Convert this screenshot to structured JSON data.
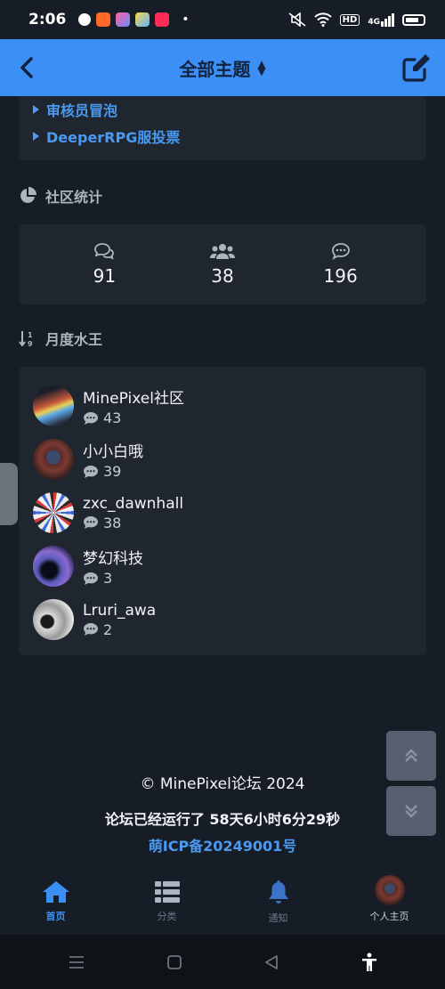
{
  "status_bar": {
    "time": "2:06",
    "notification_icons": [
      "app-icon-1",
      "app-icon-2",
      "app-icon-3",
      "app-icon-4",
      "app-icon-5"
    ],
    "dot": "•",
    "right_icons": [
      "mute-icon",
      "wifi-icon",
      "hd-icon",
      "4g-signal-icon",
      "battery-icon"
    ],
    "hd": "HD",
    "signal": "4G"
  },
  "header": {
    "title": "全部主题",
    "accent_color": "#3b8ff5"
  },
  "links": [
    {
      "label": "审核员冒泡"
    },
    {
      "label": "DeeperRPG服投票"
    }
  ],
  "community_stats": {
    "title": "社区统计",
    "items": [
      {
        "icon": "comments-icon",
        "value": "91"
      },
      {
        "icon": "users-icon",
        "value": "38"
      },
      {
        "icon": "comment-dots-icon",
        "value": "196"
      }
    ]
  },
  "monthly_top": {
    "title": "月度水王",
    "users": [
      {
        "name": "MinePixel社区",
        "count": "43"
      },
      {
        "name": "小小白哦",
        "count": "39"
      },
      {
        "name": "zxc_dawnhall",
        "count": "38"
      },
      {
        "name": "梦幻科技",
        "count": "3"
      },
      {
        "name": "Lruri_awa",
        "count": "2"
      }
    ]
  },
  "footer": {
    "copyright": "© MinePixel论坛 2024",
    "uptime": "论坛已经运行了 58天6小时6分29秒",
    "icp": "萌ICP备20249001号"
  },
  "tabbar": {
    "tabs": [
      {
        "label": "首页",
        "icon": "home-icon",
        "active": true
      },
      {
        "label": "分类",
        "icon": "list-icon",
        "active": false
      },
      {
        "label": "通知",
        "icon": "bell-icon",
        "active": false
      },
      {
        "label": "个人主页",
        "icon": "avatar",
        "active": false
      }
    ]
  }
}
